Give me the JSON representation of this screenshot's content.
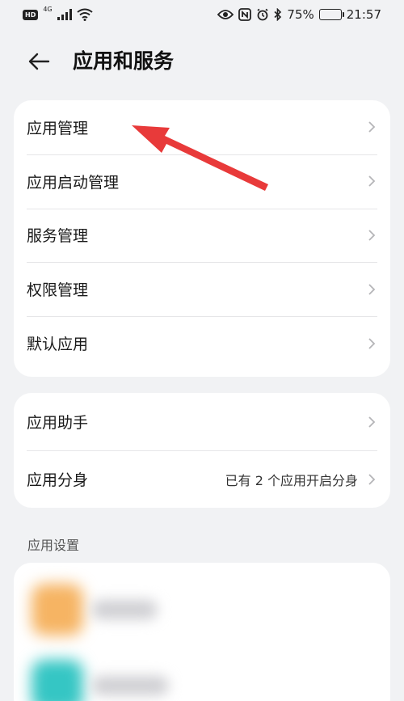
{
  "status_bar": {
    "hd": "HD",
    "network": "4G",
    "battery": "75%",
    "battery_level": 0.75,
    "time": "21:57"
  },
  "header": {
    "title": "应用和服务",
    "back_icon": "arrow-left-icon"
  },
  "group1": {
    "items": [
      {
        "label": "应用管理"
      },
      {
        "label": "应用启动管理"
      },
      {
        "label": "服务管理"
      },
      {
        "label": "权限管理"
      },
      {
        "label": "默认应用"
      }
    ]
  },
  "group2": {
    "items": [
      {
        "label": "应用助手",
        "value": ""
      },
      {
        "label": "应用分身",
        "value": "已有 2 个应用开启分身"
      }
    ]
  },
  "section": {
    "title": "应用设置"
  },
  "colors": {
    "background": "#f1f2f4",
    "card": "#ffffff",
    "annotation_arrow": "#e83a3a",
    "chevron": "#b5b5b8"
  }
}
